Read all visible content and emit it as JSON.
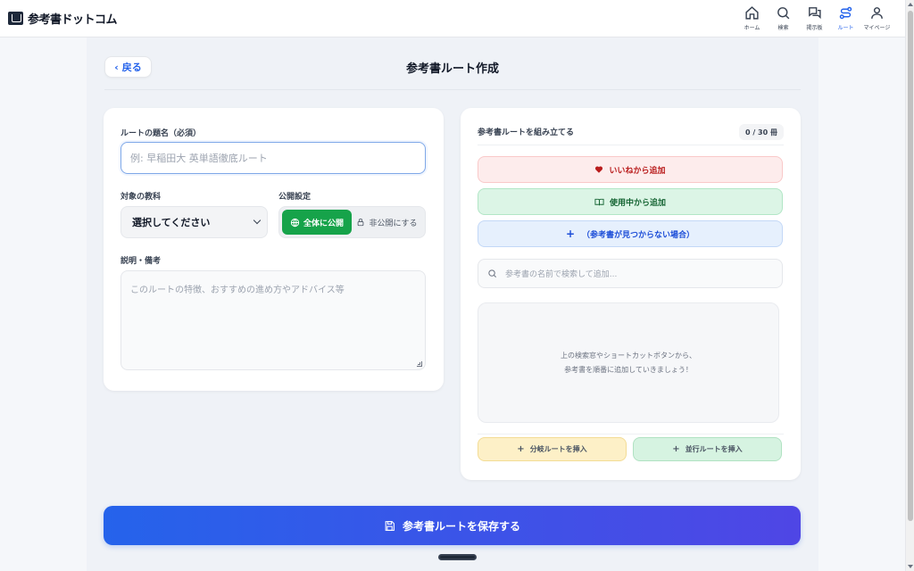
{
  "header": {
    "brand": "参考書ドットコム",
    "nav": [
      {
        "label": "ホーム",
        "icon": "home-icon"
      },
      {
        "label": "検索",
        "icon": "search-icon"
      },
      {
        "label": "掲示板",
        "icon": "chat-icon"
      },
      {
        "label": "ルート",
        "icon": "route-icon",
        "active": true
      },
      {
        "label": "マイページ",
        "icon": "user-icon"
      }
    ]
  },
  "page": {
    "back_label": "戻る",
    "title": "参考書ルート作成"
  },
  "form": {
    "title_label": "ルートの題名（必須）",
    "title_placeholder": "例: 早稲田大 英単語徹底ルート",
    "subject_label": "対象の教科",
    "subject_value": "選択してください",
    "visibility_label": "公開設定",
    "visibility_public": "全体に公開",
    "visibility_private": "非公開にする",
    "description_label": "説明・備考",
    "description_placeholder": "このルートの特徴、おすすめの進め方やアドバイス等"
  },
  "builder": {
    "heading": "参考書ルートを組み立てる",
    "counter": "0 / 30 冊",
    "add_from_likes": "いいねから追加",
    "add_from_using": "使用中から追加",
    "add_not_found": "（参考書が見つからない場合）",
    "search_placeholder": "参考書の名前で検索して追加...",
    "empty_line1": "上の検索窓やショートカットボタンから、",
    "empty_line2": "参考書を順番に追加していきましょう！",
    "insert_branch": "分岐ルートを挿入",
    "insert_parallel": "並行ルートを挿入"
  },
  "save_label": "参考書ルートを保存する",
  "colors": {
    "accent": "#2563eb",
    "public_toggle": "#16a34a",
    "save_gradient_end": "#4f46e5"
  }
}
